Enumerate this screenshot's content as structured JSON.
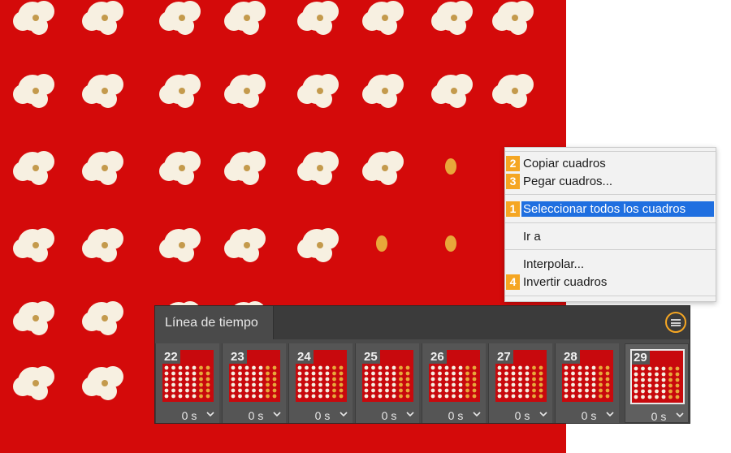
{
  "menu": {
    "items": [
      {
        "label": "Copiar cuadros",
        "step": "2",
        "highlighted": false
      },
      {
        "label": "Pegar cuadros...",
        "step": "3",
        "highlighted": false
      },
      {
        "label": "Seleccionar todos los cuadros",
        "step": "1",
        "highlighted": true
      },
      {
        "label": "Ir a",
        "step": "",
        "highlighted": false
      },
      {
        "label": "Interpolar...",
        "step": "",
        "highlighted": false
      },
      {
        "label": "Invertir cuadros",
        "step": "4",
        "highlighted": false
      }
    ]
  },
  "timeline": {
    "title": "Línea de tiempo",
    "menu_icon": "panel-menu-icon",
    "frames": [
      {
        "number": "22",
        "delay": "0 s"
      },
      {
        "number": "23",
        "delay": "0 s"
      },
      {
        "number": "24",
        "delay": "0 s"
      },
      {
        "number": "25",
        "delay": "0 s"
      },
      {
        "number": "26",
        "delay": "0 s"
      },
      {
        "number": "27",
        "delay": "0 s"
      },
      {
        "number": "28",
        "delay": "0 s"
      },
      {
        "number": "29",
        "delay": "0 s",
        "selected": true
      }
    ]
  },
  "colors": {
    "backdrop_red": "#d40a0a",
    "highlight_blue": "#1f6fe0",
    "step_orange": "#f5a623",
    "panel_gray": "#4a4a4a"
  }
}
